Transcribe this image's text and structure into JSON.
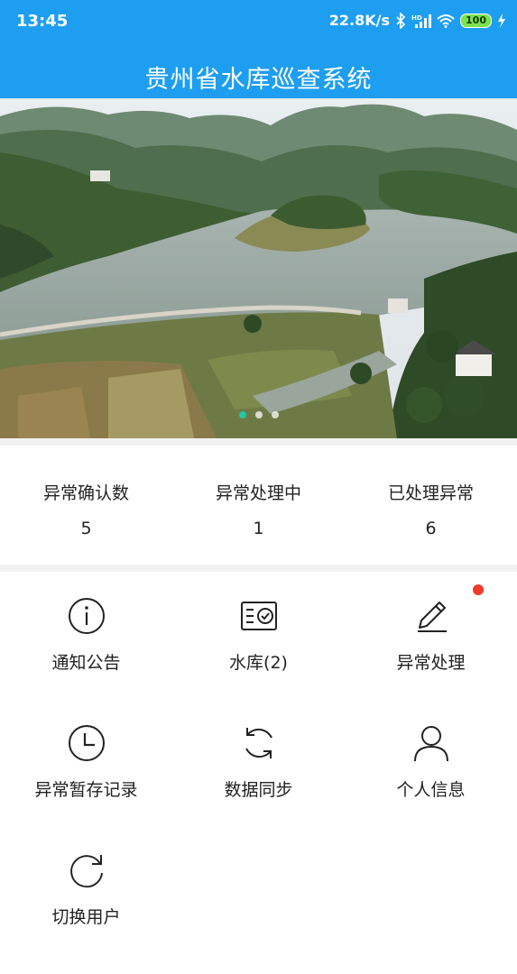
{
  "status_bar": {
    "time": "13:45",
    "network_speed": "22.8K/s",
    "battery": "100",
    "icons": [
      "bluetooth-icon",
      "signal-icon",
      "wifi-icon",
      "battery-icon",
      "charging-icon"
    ]
  },
  "header": {
    "title": "贵州省水库巡查系统",
    "background_color": "#1e9ef0"
  },
  "banner": {
    "slide_count": 3,
    "active_slide": 1
  },
  "stats": [
    {
      "label": "异常确认数",
      "value": "5"
    },
    {
      "label": "异常处理中",
      "value": "1"
    },
    {
      "label": "已处理异常",
      "value": "6"
    }
  ],
  "menu": [
    {
      "label": "通知公告",
      "icon": "info-icon"
    },
    {
      "label": "水库(2)",
      "icon": "certificate-icon"
    },
    {
      "label": "异常处理",
      "icon": "pencil-icon",
      "has_badge": true,
      "badge_color": "#f23a2a"
    },
    {
      "label": "异常暂存记录",
      "icon": "clock-icon"
    },
    {
      "label": "数据同步",
      "icon": "sync-icon"
    },
    {
      "label": "个人信息",
      "icon": "user-icon"
    },
    {
      "label": "切换用户",
      "icon": "refresh-icon"
    }
  ]
}
